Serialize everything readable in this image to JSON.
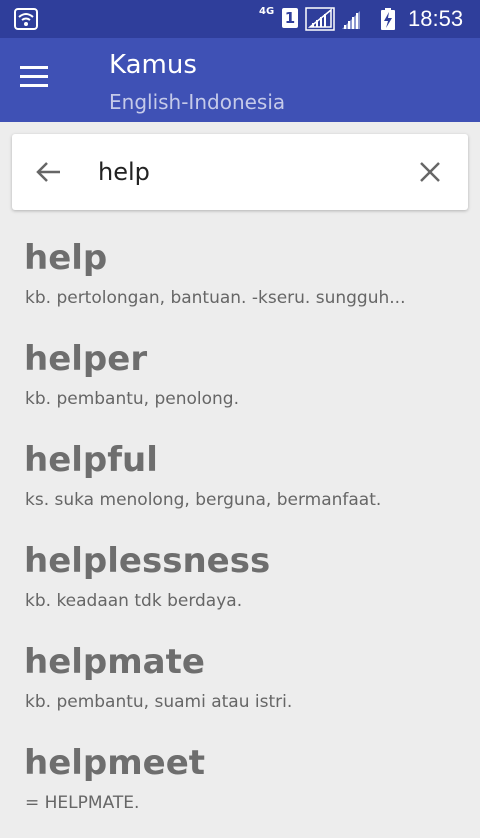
{
  "status_bar": {
    "network_type": "4G",
    "sim_slot": "1",
    "time": "18:53",
    "icons": [
      "wifi-icon",
      "signal-icon",
      "signal-icon",
      "battery-charging-icon"
    ]
  },
  "app_bar": {
    "menu_icon": "menu-icon",
    "title": "Kamus",
    "subtitle": "English-Indonesia",
    "background": "#3f51b5"
  },
  "search": {
    "value": "help",
    "back_icon": "arrow-back-icon",
    "clear_icon": "close-icon",
    "caret_color": "#e91e63"
  },
  "results": [
    {
      "word": "help",
      "definition": "kb. pertolongan, bantuan. -kseru. sungguh..."
    },
    {
      "word": "helper",
      "definition": "kb. pembantu, penolong."
    },
    {
      "word": "helpful",
      "definition": "ks. suka menolong, berguna, bermanfaat."
    },
    {
      "word": "helplessness",
      "definition": "kb. keadaan tdk berdaya."
    },
    {
      "word": "helpmate",
      "definition": "kb. pembantu, suami atau istri."
    },
    {
      "word": "helpmeet",
      "definition": "= HELPMATE."
    }
  ]
}
